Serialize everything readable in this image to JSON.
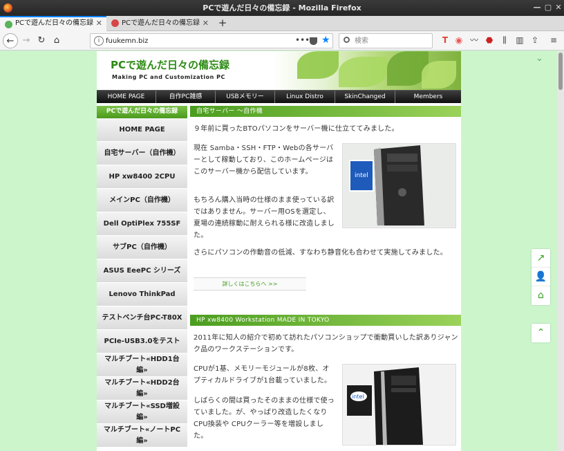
{
  "window": {
    "title": "PCで遊んだ日々の備忘録 - Mozilla Firefox"
  },
  "tabs": [
    {
      "label": "PCで遊んだ日々の備忘録"
    },
    {
      "label": "PCで遊んだ日々の備忘録"
    }
  ],
  "urlbar": {
    "url": "fuukemn.biz",
    "search_placeholder": "検索"
  },
  "site": {
    "title": "PCで遊んだ日々の備忘録",
    "subtitle": "Making PC and Customization PC"
  },
  "menu": [
    "HOME PAGE",
    "自作PC雑感",
    "USBメモリー",
    "Linux Distro",
    "SkinChanged",
    "Members"
  ],
  "sidebar": {
    "heading": "PCで遊んだ日々の備忘録",
    "items": [
      "HOME PAGE",
      "自宅サーバー（自作機）",
      "HP xw8400 2CPU",
      "メインPC（自作機）",
      "Dell OptiPlex 755SF",
      "サブPC（自作機）",
      "ASUS EeePC シリーズ",
      "Lenovo ThinkPad",
      "テストベンチ台PC-T80X",
      "PCIe-USB3.0をテスト",
      "マルチブート«HDD1台編»",
      "マルチブート«HDD2台編»",
      "マルチブート«SSD増設編»",
      "マルチブート«ノートPC編»"
    ]
  },
  "sections": [
    {
      "heading": "自宅サーバー ～自作機",
      "intro": "９年前に買ったBTOパソコンをサーバー機に仕立ててみました。",
      "p1": "現在 Samba・SSH・FTP・Webの各サーバーとして稼動しており、このホームページはこのサーバー機から配信しています。",
      "p2": "もちろん購入当時の仕様のまま使っている訳ではありません。サーバー用OSを選定し、夏場の連続稼動に耐えられる様に改造しました。",
      "p3": "さらにパソコンの作動音の低減、すなわち静音化も合わせて実施してみました。",
      "more": "詳しくはこちらへ >>"
    },
    {
      "heading": "HP xw8400 Workstation MADE IN TOKYO",
      "intro": "2011年に知人の紹介で初めて訪れたパソコンショップで衝動買いした訳ありジャンク品のワークステーションです。",
      "p1": "CPUが1基、メモリーモジュールが8枚、オプティカルドライブが1台載っていました。",
      "p2": "しばらくの間は買ったそのままの仕様で使っていました。が、やっぱり改造したくなり CPU換装や CPUクーラー等を増設しました。"
    }
  ],
  "colors": {
    "accent": "#4a9a1c",
    "page_bg": "#ccf5cc",
    "menu_bg": "#1a1a1a"
  }
}
